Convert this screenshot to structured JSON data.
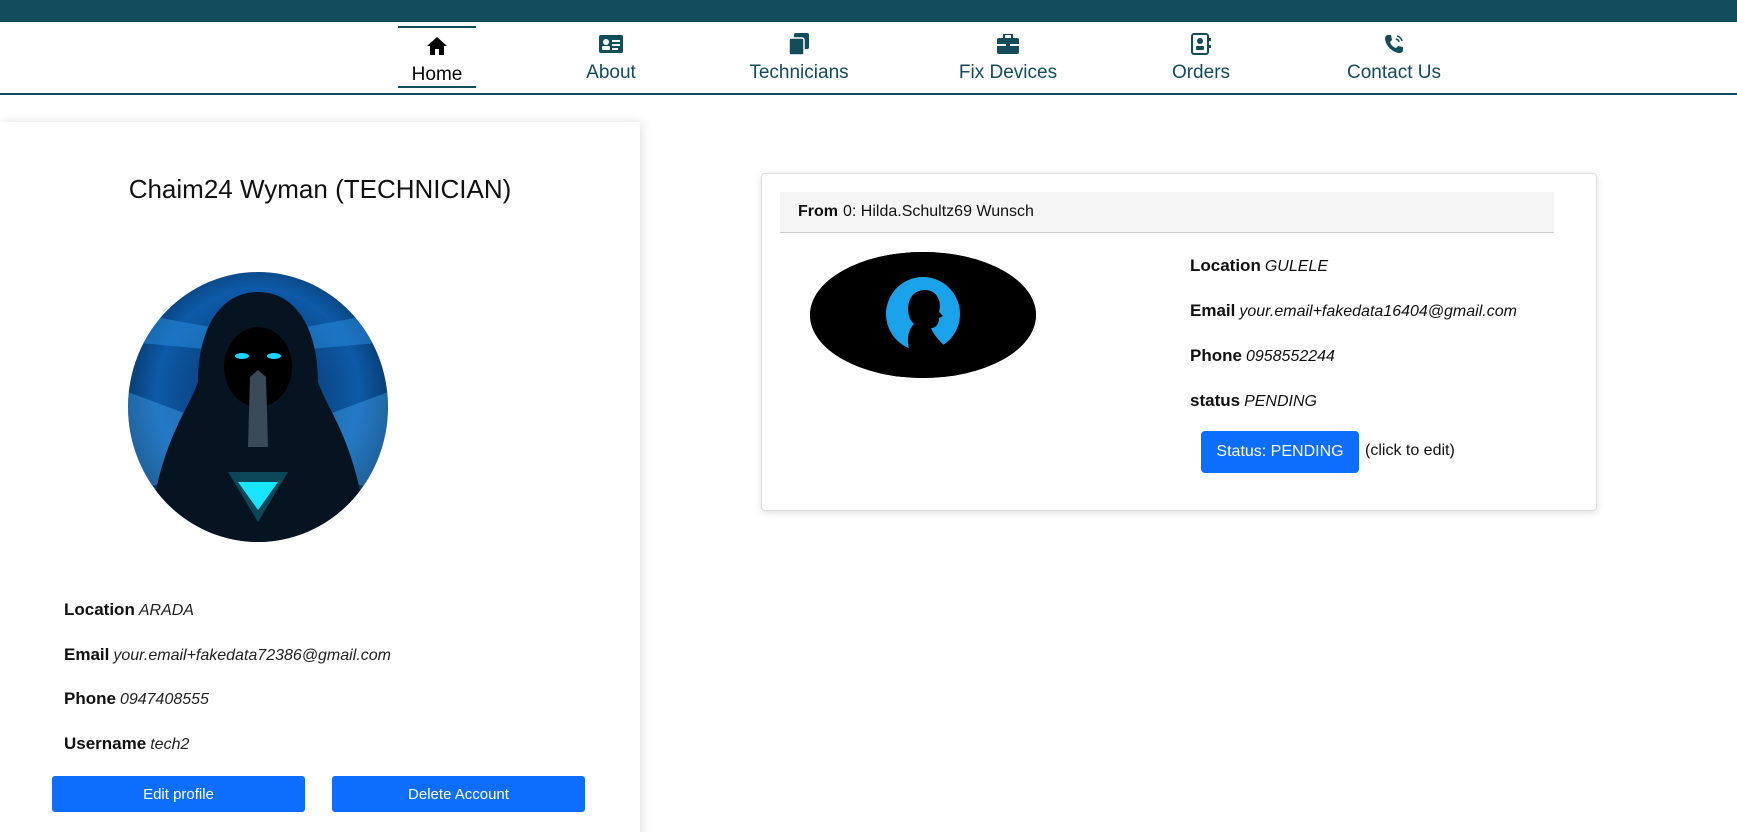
{
  "nav": {
    "items": [
      {
        "label": "Home",
        "icon": "home-icon"
      },
      {
        "label": "About",
        "icon": "id-card-icon"
      },
      {
        "label": "Technicians",
        "icon": "copy-icon"
      },
      {
        "label": "Fix Devices",
        "icon": "briefcase-icon"
      },
      {
        "label": "Orders",
        "icon": "address-book-icon"
      },
      {
        "label": "Contact Us",
        "icon": "phone-icon"
      }
    ],
    "active": "Home"
  },
  "profile": {
    "title": "Chaim24 Wyman (TECHNICIAN)",
    "location_label": "Location",
    "location": "ARADA",
    "email_label": "Email",
    "email": "your.email+fakedata72386@gmail.com",
    "phone_label": "Phone",
    "phone": "0947408555",
    "username_label": "Username",
    "username": "tech2",
    "edit_label": "Edit profile",
    "delete_label": "Delete Account"
  },
  "order": {
    "from_label": "From",
    "from_value": "0: Hilda.Schultz69 Wunsch",
    "location_label": "Location",
    "location": "GULELE",
    "email_label": "Email",
    "email": "your.email+fakedata16404@gmail.com",
    "phone_label": "Phone",
    "phone": "0958552244",
    "status_label": "status",
    "status": "PENDING",
    "status_button": "Status: PENDING",
    "click_note": "(click to edit)"
  },
  "colors": {
    "brand": "#134c5a",
    "primary_button": "#0d6efd"
  }
}
